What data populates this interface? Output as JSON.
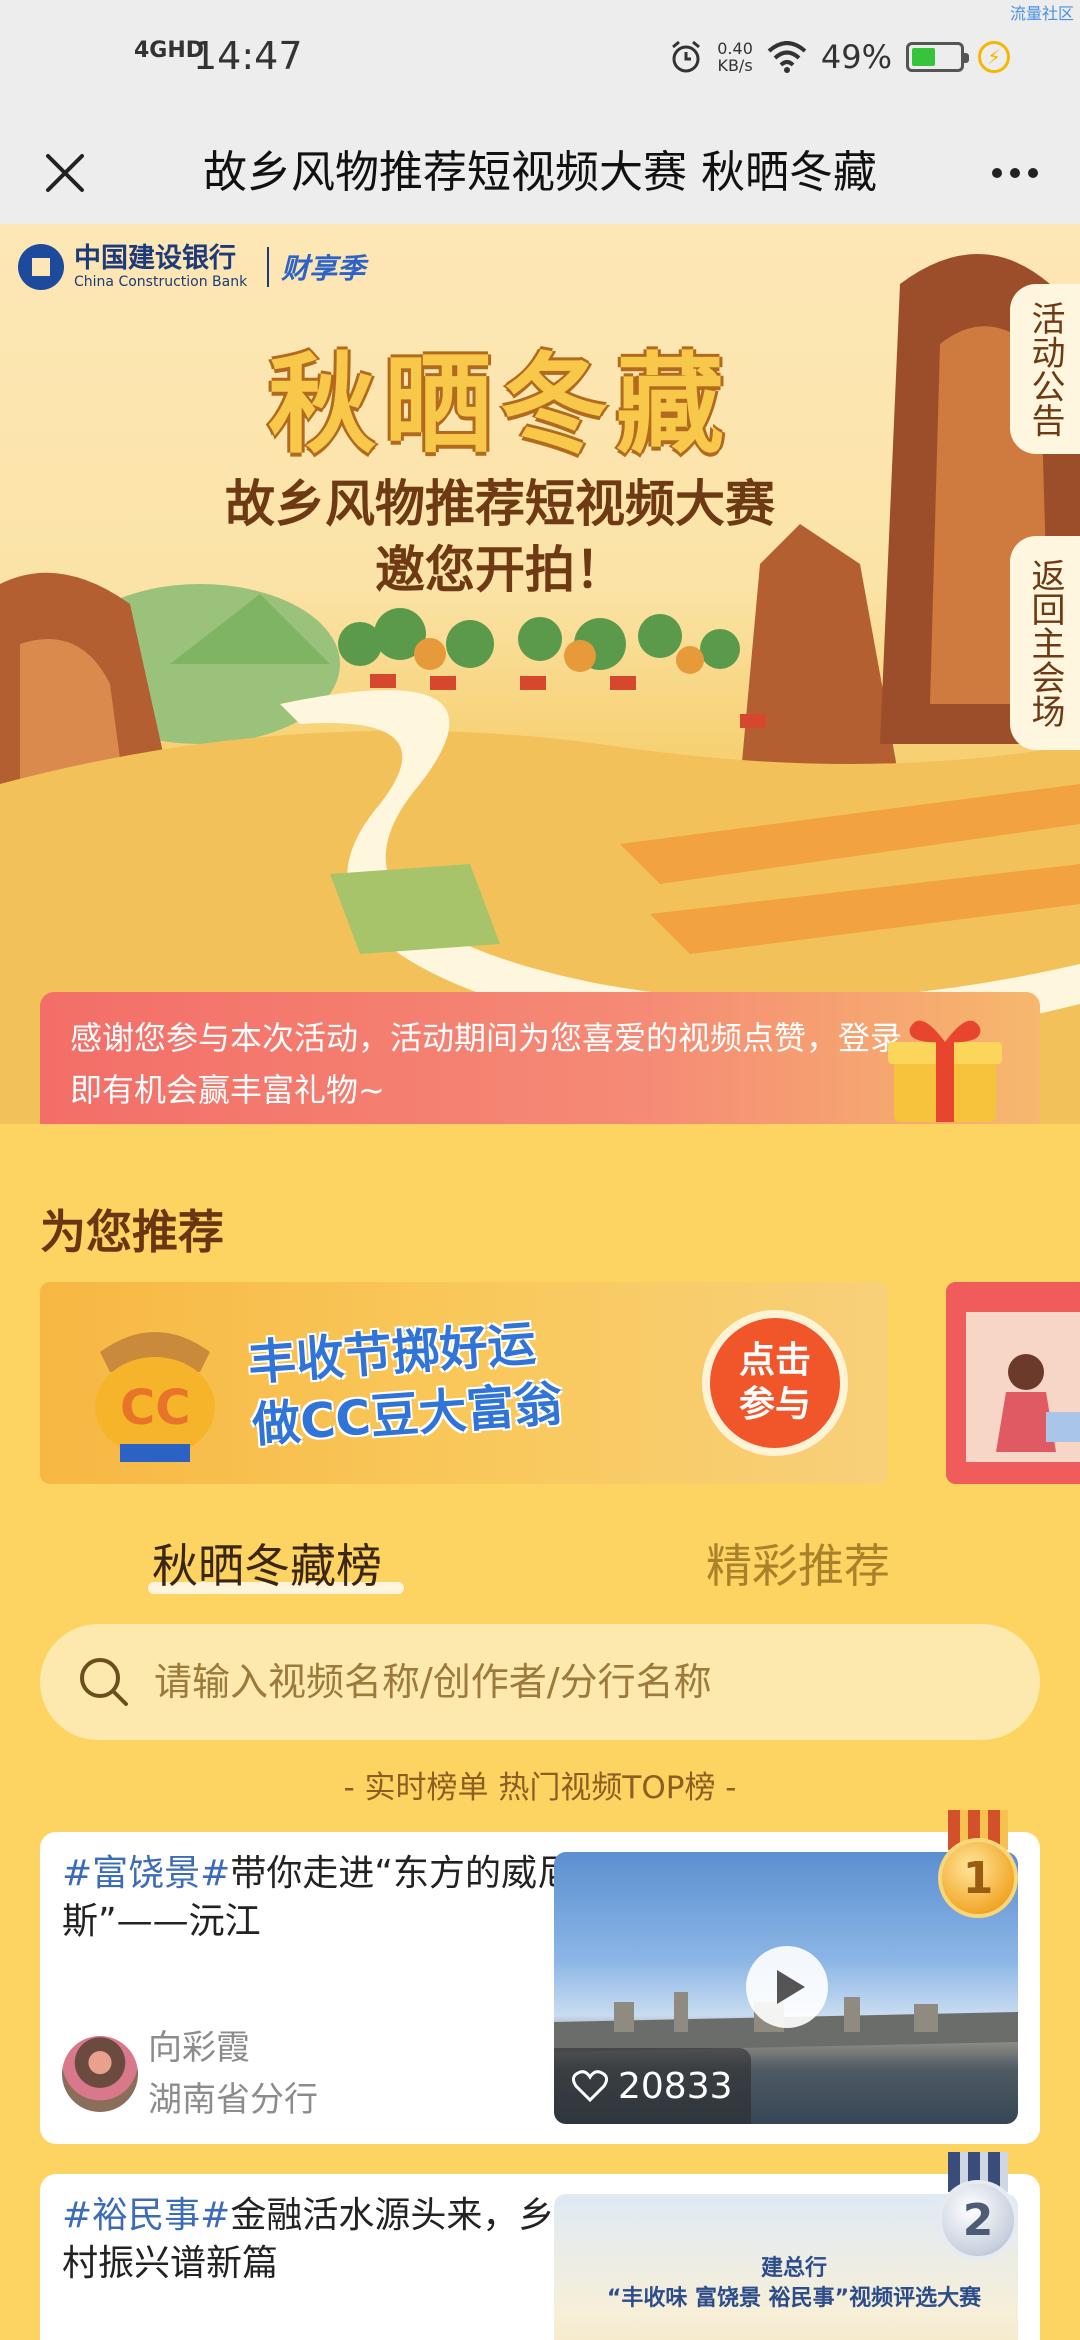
{
  "status_bar": {
    "network": "4GHD",
    "time": "14:47",
    "speed_value": "0.40",
    "speed_unit": "KB/s",
    "battery_percent": "49%",
    "battery_level": 0.49,
    "corner_label": "流量社区"
  },
  "title_bar": {
    "title": "故乡风物推荐短视频大赛 秋晒冬藏"
  },
  "banner": {
    "bank_name_cn": "中国建设银行",
    "bank_name_en": "China Construction Bank",
    "bank_campaign": "财享季",
    "main_title": "秋晒冬藏",
    "subtitle": "故乡风物推荐短视频大赛",
    "invite": "邀您开拍！",
    "tab_notice": "活动公告",
    "tab_return": "返回主会场",
    "thanks_text": "感谢您参与本次活动，活动期间为您喜爱的视频点赞，登录即有机会赢丰富礼物~"
  },
  "recommend": {
    "section_title": "为您推荐",
    "promo_text_line1": "丰收节掷好运",
    "promo_text_line2": "做CC豆大富翁",
    "promo_join_line1": "点击",
    "promo_join_line2": "参与"
  },
  "tabs": {
    "active": "秋晒冬藏榜",
    "inactive": "精彩推荐"
  },
  "search": {
    "placeholder": "请输入视频名称/创作者/分行名称"
  },
  "rank_caption": "- 实时榜单 热门视频TOP榜 -",
  "videos": [
    {
      "tag": "#富饶景#",
      "title": "带你走进“东方的威尼斯”——沅江",
      "author": "向彩霞",
      "branch": "湖南省分行",
      "likes": "20833",
      "rank": "1"
    },
    {
      "tag": "#裕民事#",
      "title": "金融活水源头来，乡村振兴谱新篇",
      "rank": "2",
      "thumb_text_line1": "建总行",
      "thumb_text_line2": "“丰收味 富饶景 裕民事”视频评选大赛"
    }
  ],
  "colors": {
    "page_bg": "#fdd361",
    "accent_brown": "#6a3512",
    "tag_blue": "#3c6cb8"
  }
}
